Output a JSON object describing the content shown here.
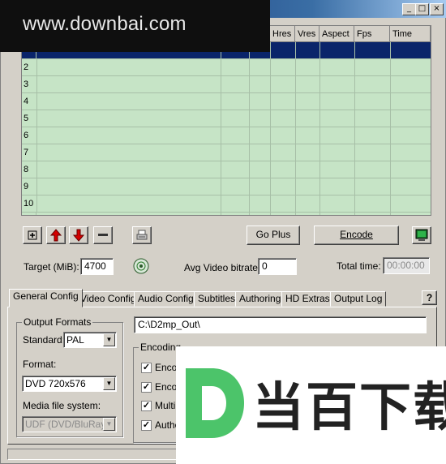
{
  "window": {
    "title_buttons": [
      "_",
      "□",
      "×"
    ]
  },
  "watermark": {
    "text": "www.downbai.com"
  },
  "grid": {
    "columns": [
      "Hres",
      "Vres",
      "Aspect",
      "Fps",
      "Time"
    ],
    "row_numbers": [
      "2",
      "3",
      "4",
      "5",
      "6",
      "7",
      "8",
      "9",
      "10"
    ],
    "body_color": "#c6e4c6",
    "selected_row_color": "#0a246a"
  },
  "toolbar": {
    "add_icon": "plus-icon",
    "up_icon": "red-up-arrow-icon",
    "down_icon": "red-down-arrow-icon",
    "remove_icon": "minus-icon",
    "print_icon": "printer-icon",
    "go_plus_label": "Go Plus",
    "encode_label": "Encode",
    "monitor_icon": "monitor-icon"
  },
  "target": {
    "label": "Target (MiB):",
    "value": "4700"
  },
  "bitrate": {
    "label": "Avg Video bitrate:",
    "value": "0",
    "disc_icon": "cd-icon"
  },
  "total_time": {
    "label": "Total time:",
    "value": "00:00:00"
  },
  "tabs": [
    "General Config",
    "Video Config",
    "Audio Config",
    "Subtitles",
    "Authoring",
    "HD Extras",
    "Output Log"
  ],
  "help_label": "?",
  "general": {
    "output_formats": {
      "title": "Output Formats",
      "standard_label": "Standard:",
      "standard_value": "PAL",
      "format_label": "Format:",
      "format_value": "DVD 720x576",
      "media_label": "Media file system:",
      "media_value": "UDF (DVD/BluRay)"
    },
    "output_path": "C:\\D2mp_Out\\",
    "encoding_group_title": "Encoding",
    "options": [
      "Enco",
      "Enco",
      "Multip",
      "Autho"
    ]
  },
  "logo": {
    "text": "当百下载",
    "accent": "#4cc46a"
  }
}
